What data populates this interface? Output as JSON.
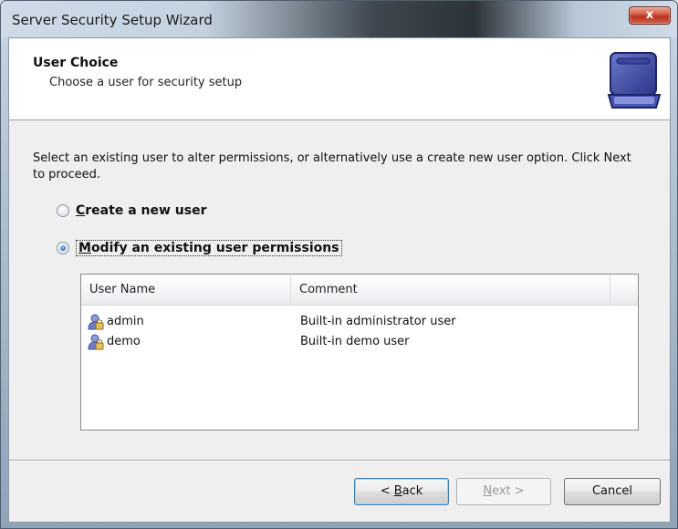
{
  "window": {
    "title": "Server Security Setup Wizard",
    "close_label": "x"
  },
  "header": {
    "title": "User Choice",
    "subtitle": "Choose a user for security setup",
    "icon": "briefcase-icon"
  },
  "instructions": "Select an existing user to alter permissions, or alternatively use a create new user option. Click Next to proceed.",
  "options": {
    "create": {
      "first": "C",
      "rest": "reate a new user",
      "selected": false
    },
    "modify": {
      "first": "M",
      "rest": "odify an existing user permissions",
      "selected": true
    }
  },
  "user_table": {
    "columns": [
      "User Name",
      "Comment"
    ],
    "rows": [
      {
        "name": "admin",
        "comment": "Built-in administrator user",
        "icon": "user-lock-icon"
      },
      {
        "name": "demo",
        "comment": "Built-in demo user",
        "icon": "user-lock-icon"
      }
    ]
  },
  "buttons": {
    "back": {
      "prefix": "< ",
      "accel": "B",
      "rest": "ack"
    },
    "next": {
      "accel": "N",
      "rest": "ext >",
      "disabled": true
    },
    "cancel": "Cancel"
  },
  "colors": {
    "accent": "#3c7fb1",
    "close_red": "#c8432b",
    "header_bg": "#ffffff"
  }
}
